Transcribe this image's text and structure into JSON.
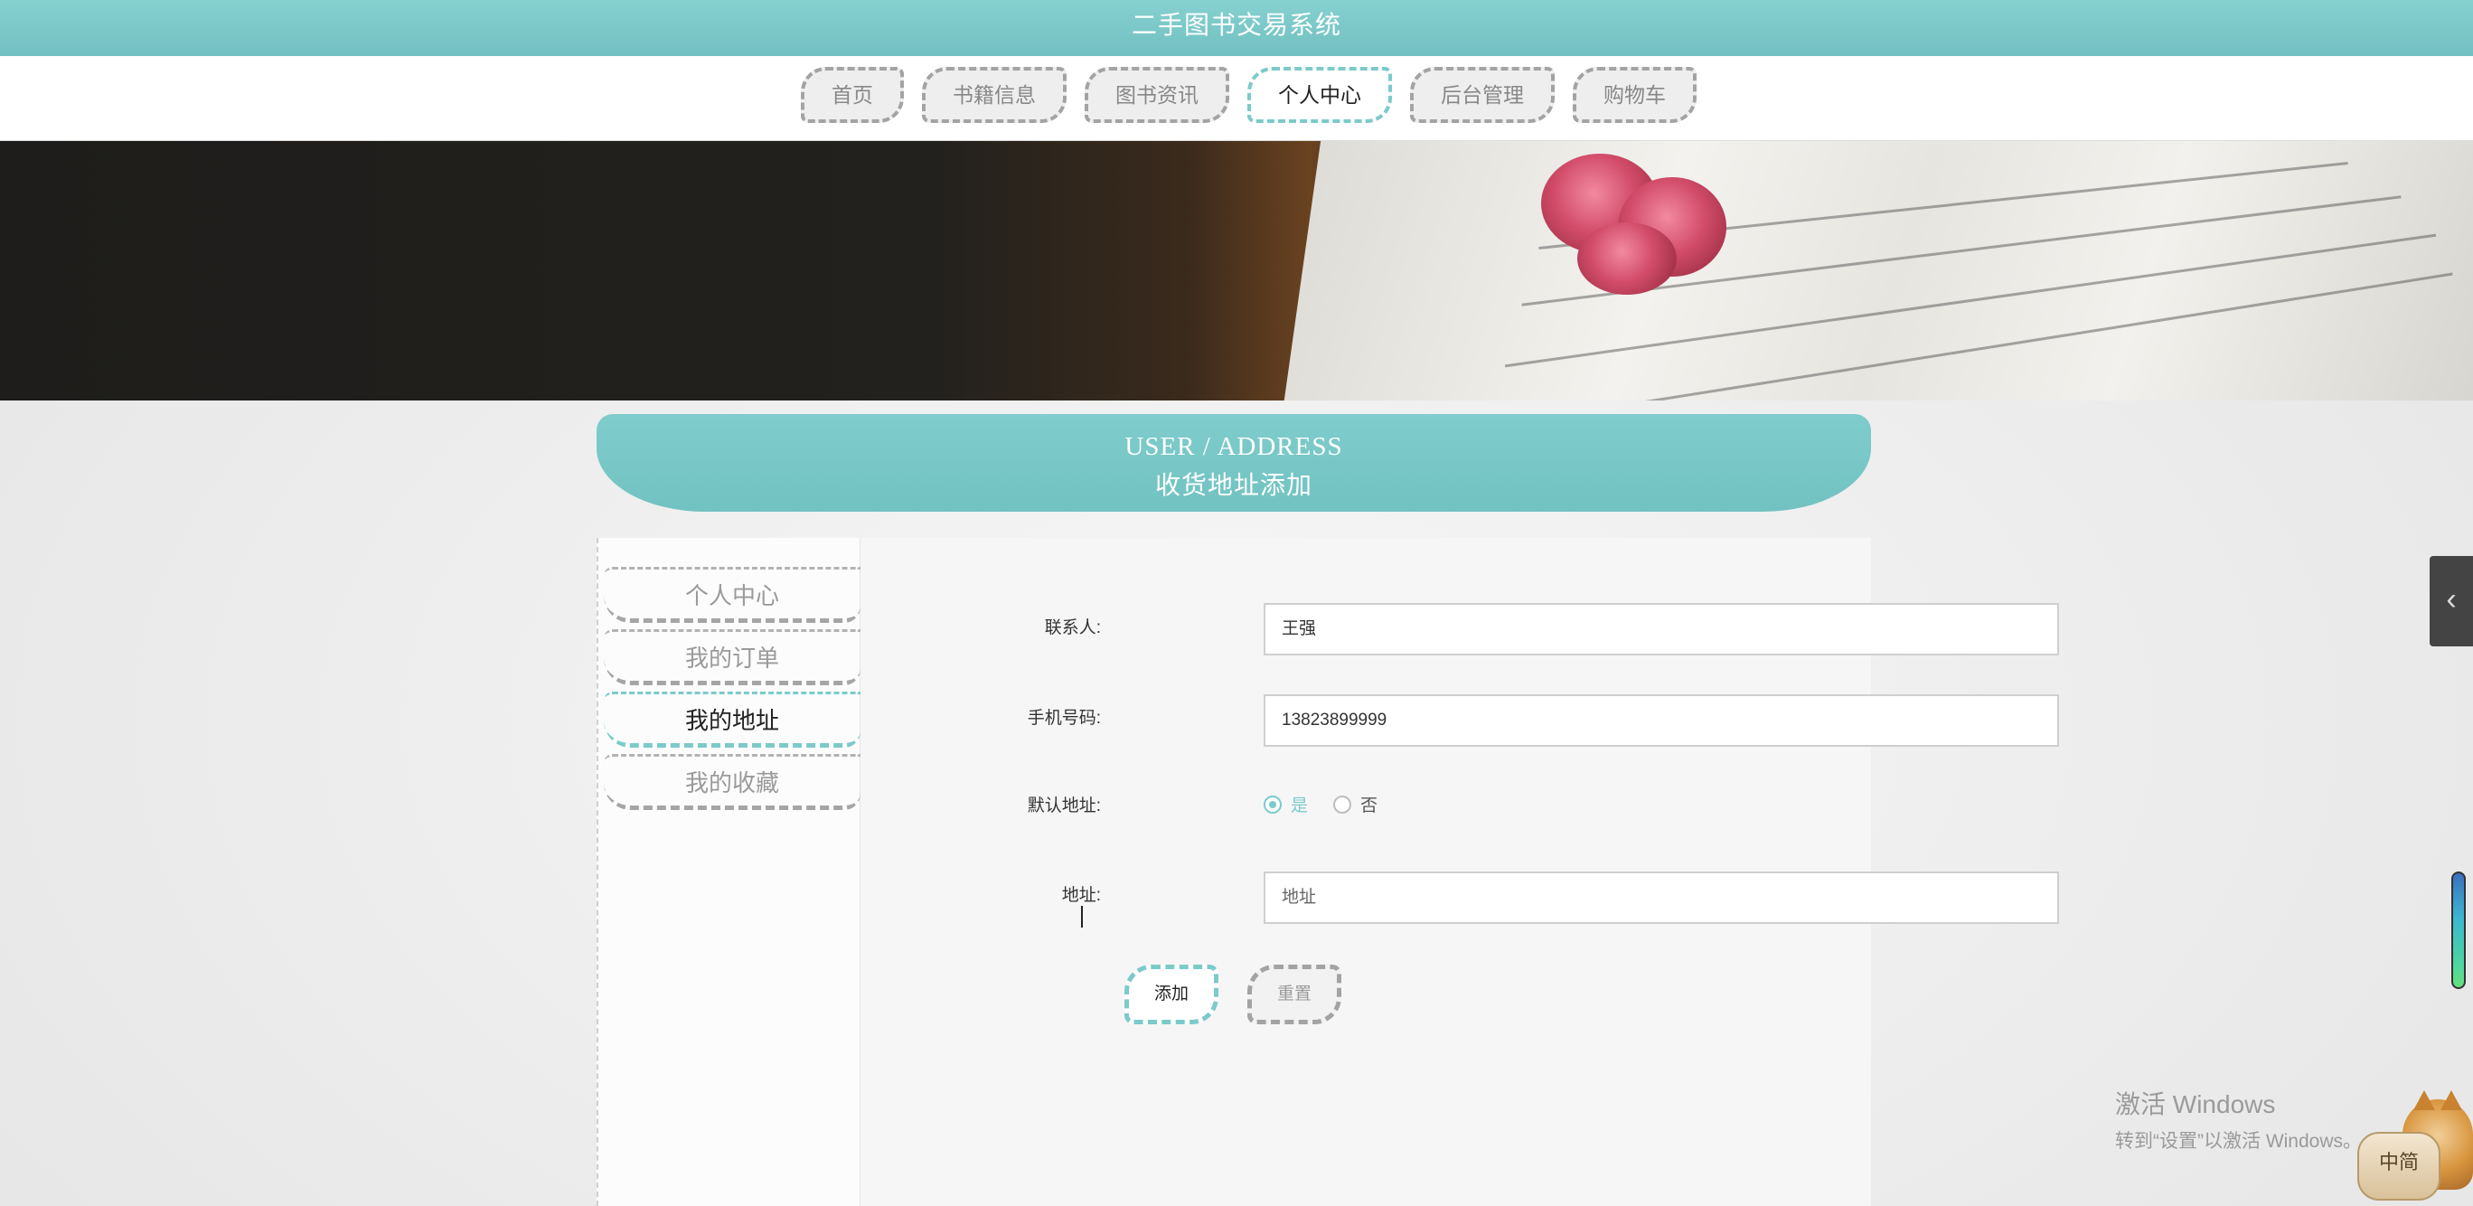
{
  "site": {
    "title": "二手图书交易系统"
  },
  "nav": {
    "items": [
      {
        "label": "首页"
      },
      {
        "label": "书籍信息"
      },
      {
        "label": "图书资讯"
      },
      {
        "label": "个人中心",
        "active": true
      },
      {
        "label": "后台管理"
      },
      {
        "label": "购物车"
      }
    ]
  },
  "section": {
    "title_en": "USER / ADDRESS",
    "title_cn": "收货地址添加"
  },
  "sidebar": {
    "items": [
      {
        "label": "个人中心"
      },
      {
        "label": "我的订单"
      },
      {
        "label": "我的地址",
        "active": true
      },
      {
        "label": "我的收藏"
      }
    ]
  },
  "form": {
    "contact_label": "联系人:",
    "contact_value": "王强",
    "phone_label": "手机号码:",
    "phone_value": "13823899999",
    "default_label": "默认地址:",
    "default_yes": "是",
    "default_no": "否",
    "default_selected": "是",
    "address_label": "地址:",
    "address_placeholder": "地址",
    "add_button": "添加",
    "reset_button": "重置"
  },
  "side_tab": {
    "icon": "chevron-left-icon",
    "glyph": "‹"
  },
  "windows_watermark": {
    "title": "激活 Windows",
    "subtitle": "转到“设置”以激活 Windows。"
  },
  "ime": {
    "label": "中简"
  },
  "colors": {
    "accent": "#7ccaca",
    "header": "#7fcccc",
    "inactive_border": "#a3a3a3"
  }
}
